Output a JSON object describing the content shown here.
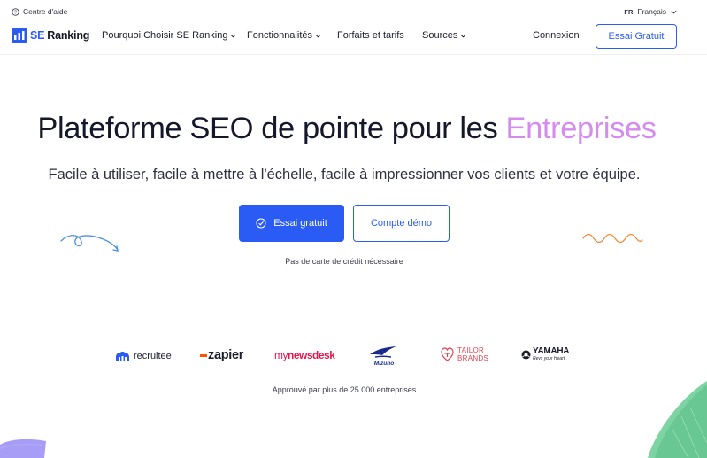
{
  "utility": {
    "help_label": "Centre d'aide",
    "lang_code": "FR",
    "lang_label": "Français"
  },
  "nav": {
    "logo_se": "SE",
    "logo_ranking": "Ranking",
    "items": [
      {
        "label": "Pourquoi Choisir SE Ranking",
        "dropdown": true
      },
      {
        "label": "Fonctionnalités",
        "dropdown": true
      },
      {
        "label": "Forfaits et tarifs",
        "dropdown": false
      },
      {
        "label": "Sources",
        "dropdown": true
      }
    ],
    "login": "Connexion",
    "trial": "Essai Gratuit"
  },
  "hero": {
    "title_main": "Plateforme SEO de pointe pour les ",
    "title_accent": "Entreprises",
    "subtitle": "Facile à utiliser, facile à mettre à l'échelle, facile à impressionner vos clients et votre équipe.",
    "primary_cta": "Essai gratuit",
    "secondary_cta": "Compte démo",
    "note": "Pas de carte de crédit nécessaire"
  },
  "brands": {
    "recruitee": "recruitee",
    "zapier": "zapier",
    "newsdesk_my": "my",
    "newsdesk_rest": "newsdesk",
    "mizuno": "Mizuno",
    "tailor_line1": "TAILOR",
    "tailor_line2": "BRANDS",
    "yamaha": "YAMAHA",
    "yamaha_tag": "Revs your Heart",
    "approved": "Approuvé par plus de 25 000 entreprises"
  },
  "colors": {
    "accent_blue": "#2b5bf5",
    "title_accent": "#d48cf0",
    "squiggle_blue": "#4a90e2",
    "squiggle_orange": "#f28b3c",
    "deco_green": "#7ed3a3",
    "deco_purple": "#8a7cf3"
  }
}
